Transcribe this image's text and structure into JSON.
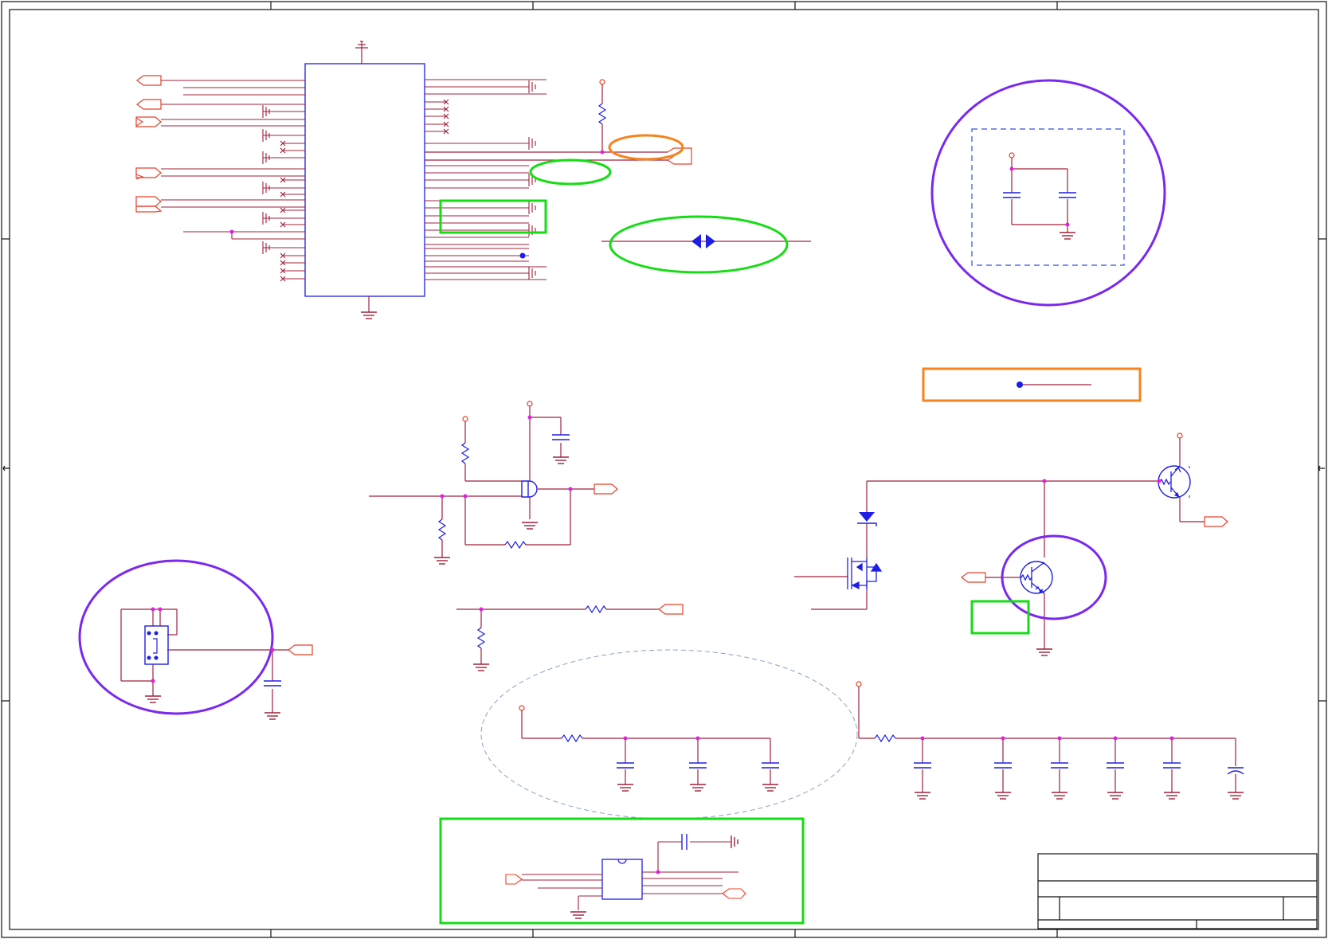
{
  "diagram": {
    "type": "electrical-schematic",
    "colors": {
      "wire": "#a0203a",
      "component": "#1e1ee6",
      "port": "#e8402a",
      "junction": "#e020e0",
      "border": "#111111",
      "highlight_purple": "#7a28f0",
      "highlight_green": "#14dd14",
      "highlight_orange": "#f5841f",
      "dashed_guide": "#8aa0c8"
    },
    "icons": [
      "ic-chip-icon",
      "resistor-icon",
      "capacitor-icon",
      "ground-icon",
      "power-pin-icon",
      "and-gate-icon",
      "npn-transistor-icon",
      "mosfet-icon",
      "zener-diode-icon",
      "dip-switch-icon",
      "off-page-connector-icon",
      "title-block-icon"
    ],
    "text": []
  }
}
